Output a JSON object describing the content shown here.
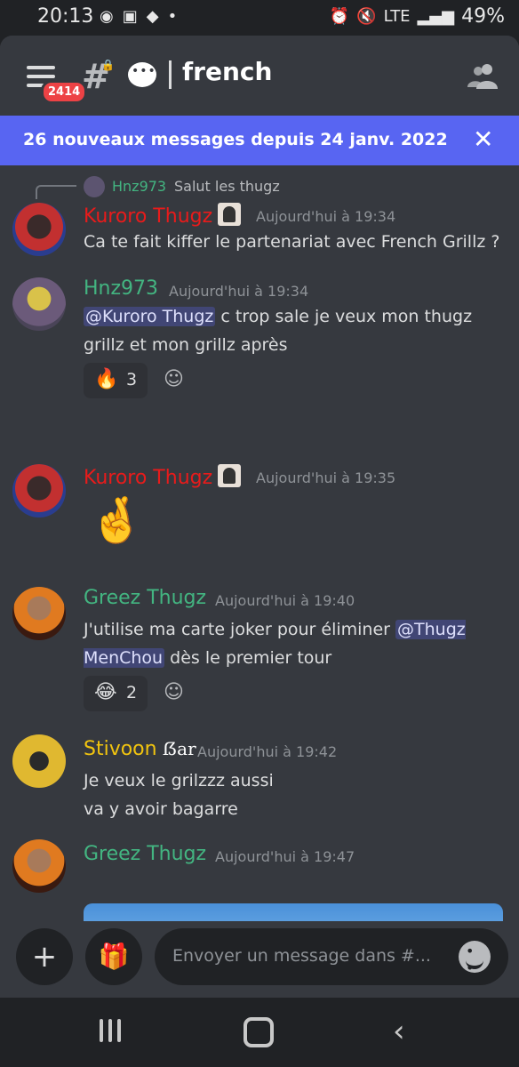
{
  "status_bar": {
    "time": "20:13",
    "battery": "49%",
    "network": "LTE"
  },
  "header": {
    "unread_badge": "2414",
    "channel_name": "french"
  },
  "banner": {
    "count": "26",
    "text": "nouveaux messages depuis 24 janv. 2022",
    "close": "✕"
  },
  "reply_preview": {
    "author": "Hnz973",
    "text": "Salut les thugz"
  },
  "messages": [
    {
      "author": "Kuroro Thugz",
      "timestamp": "Aujourd'hui à 19:34",
      "text": "Ca te fait kiffer le partenariat avec French Grillz ?"
    },
    {
      "author": "Hnz973",
      "timestamp": "Aujourd'hui à 19:34",
      "mention": "@Kuroro Thugz",
      "text_after_mention": " c trop sale je veux mon thugz grillz et mon grillz après",
      "reaction": {
        "emoji": "🔥",
        "count": "3"
      }
    },
    {
      "author": "Kuroro Thugz",
      "timestamp": "Aujourd'hui à 19:35",
      "emoji": "🤞"
    },
    {
      "author": "Greez Thugz",
      "timestamp": "Aujourd'hui à 19:40",
      "text_before_mention": "J'utilise ma carte joker pour éliminer ",
      "mention": "@Thugz MenChou",
      "text_after_mention": " dès le premier tour",
      "reaction": {
        "emoji": "😂",
        "count": "2"
      }
    },
    {
      "author": "Stivoon",
      "author_tag": "ẞar",
      "timestamp": "Aujourd'hui à 19:42",
      "line1": "Je veux le grilzzz aussi",
      "line2": "va y avoir bagarre"
    },
    {
      "author": "Greez Thugz",
      "timestamp": "Aujourd'hui à 19:47"
    }
  ],
  "composer": {
    "placeholder": "Envoyer un message dans #...",
    "add_label": "+",
    "gift_label": "🎁"
  },
  "colors": {
    "background": "#36393f",
    "banner": "#5865f2",
    "author_red": "#e81b1b",
    "author_green": "#43b581",
    "author_gold": "#f1c40f"
  }
}
